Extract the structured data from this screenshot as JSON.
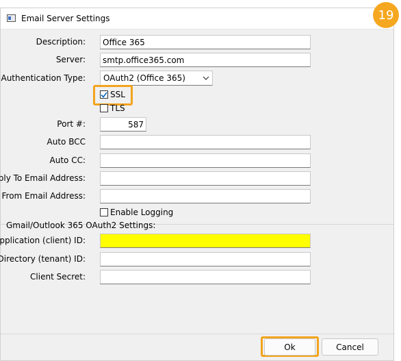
{
  "window": {
    "title": "Email Server Settings"
  },
  "badge": {
    "number": "19"
  },
  "form": {
    "description_label": "Description:",
    "description_value": "Office 365",
    "server_label": "Server:",
    "server_value": "smtp.office365.com",
    "auth_label": "Authentication Type:",
    "auth_value": "OAuth2 (Office 365)",
    "ssl_label": "SSL",
    "ssl_checked": true,
    "tls_label": "TLS",
    "tls_checked": false,
    "port_label": "Port #:",
    "port_value": "587",
    "auto_bcc_label": "Auto BCC",
    "auto_bcc_value": "",
    "auto_cc_label": "Auto CC:",
    "auto_cc_value": "",
    "reply_to_label": "Reply To Email Address:",
    "reply_to_value": "",
    "from_label": "From Email Address:",
    "from_value": "",
    "logging_label": "Enable Logging",
    "logging_checked": false
  },
  "oauth": {
    "section_label": "Gmail/Outlook 365 OAuth2 Settings:",
    "client_id_label": "Application (client) ID:",
    "client_id_value": "",
    "tenant_id_label": "Directory (tenant) ID:",
    "tenant_id_value": "",
    "secret_label": "Client Secret:",
    "secret_value": ""
  },
  "buttons": {
    "ok": "Ok",
    "cancel": "Cancel"
  },
  "colors": {
    "highlight": "#f3a41d",
    "badge": "#f5a71f",
    "client_id_bg": "#ffff00",
    "check": "#0067c0"
  }
}
